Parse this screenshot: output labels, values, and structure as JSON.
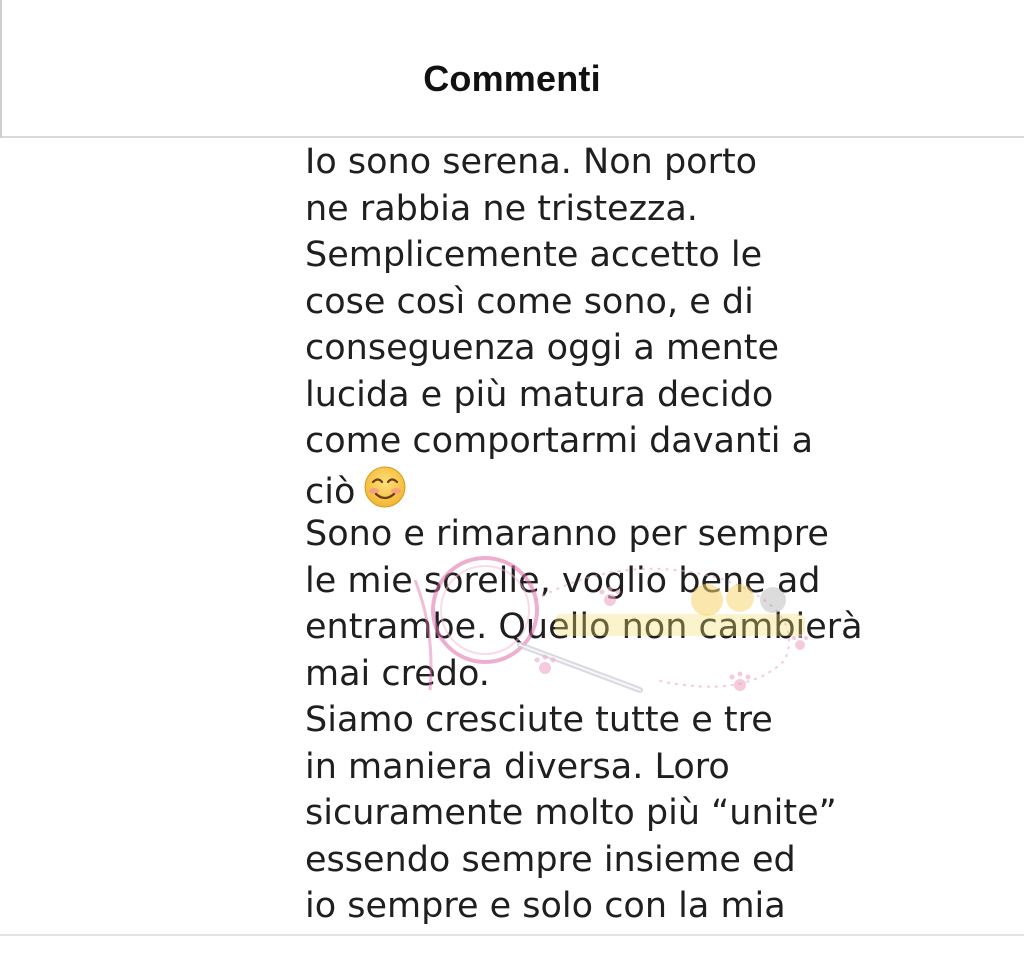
{
  "header": {
    "title": "Commenti"
  },
  "comment": {
    "lines": [
      "Io sono serena. Non porto",
      "ne rabbia ne tristezza.",
      "Semplicemente accetto le",
      "cose così come sono, e di",
      "conseguenza oggi a mente",
      "lucida e più matura decido",
      "come comportarmi davanti a",
      "ciò",
      "Sono e rimaranno per sempre",
      "le mie sorelle, voglio bene ad",
      "entrambe. Quello non cambierà",
      "mai credo.",
      "Siamo cresciute tutte e tre",
      "in maniera diversa. Loro",
      "sicuramente molto più “unite”",
      "essendo sempre insieme ed",
      "io sempre e solo con la mia"
    ],
    "emoji": "smiling-face-with-smiling-eyes-icon"
  },
  "colors": {
    "text": "#1f1f1f",
    "title": "#111111",
    "divider": "#d9d9d9",
    "emoji_face": "#f7c646",
    "emoji_blush": "#f29a8a",
    "watermark_pink": "#e06ca8"
  }
}
